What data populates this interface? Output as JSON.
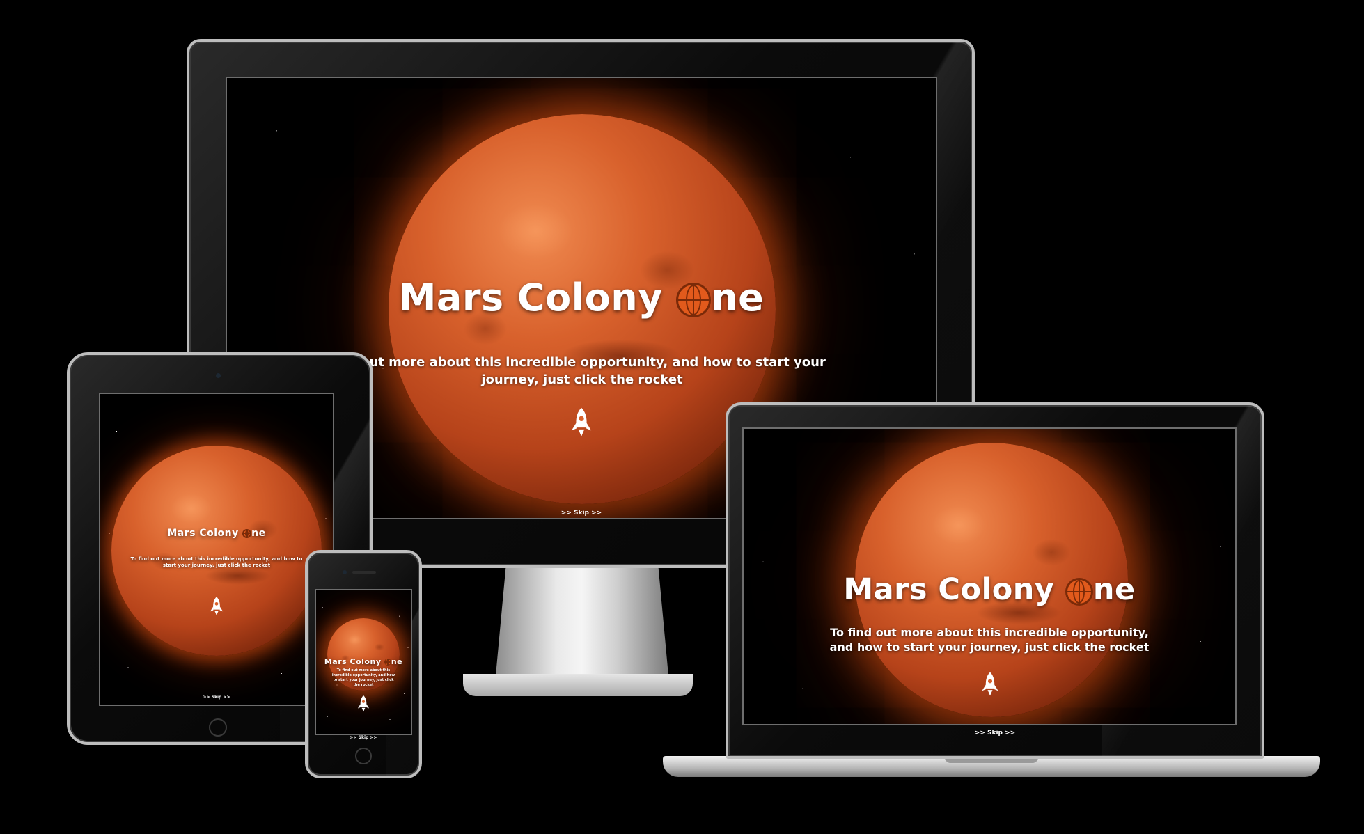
{
  "site": {
    "title_prefix": "Mars Colony ",
    "title_suffix": "ne",
    "globe_icon": "globe-icon",
    "tagline": "To find out more about this incredible opportunity, and how to start your journey, just click the rocket",
    "desktop_tagline_line1": "nd out more about this incredible opportunity, and how to start your",
    "desktop_tagline_line2": "journey, just click the rocket",
    "rocket_icon": "rocket-icon",
    "skip_label": ">> Skip >>"
  },
  "colors": {
    "background": "#000000",
    "planet": "#d8612c",
    "glow": "#ff5f14",
    "text": "#ffffff"
  }
}
